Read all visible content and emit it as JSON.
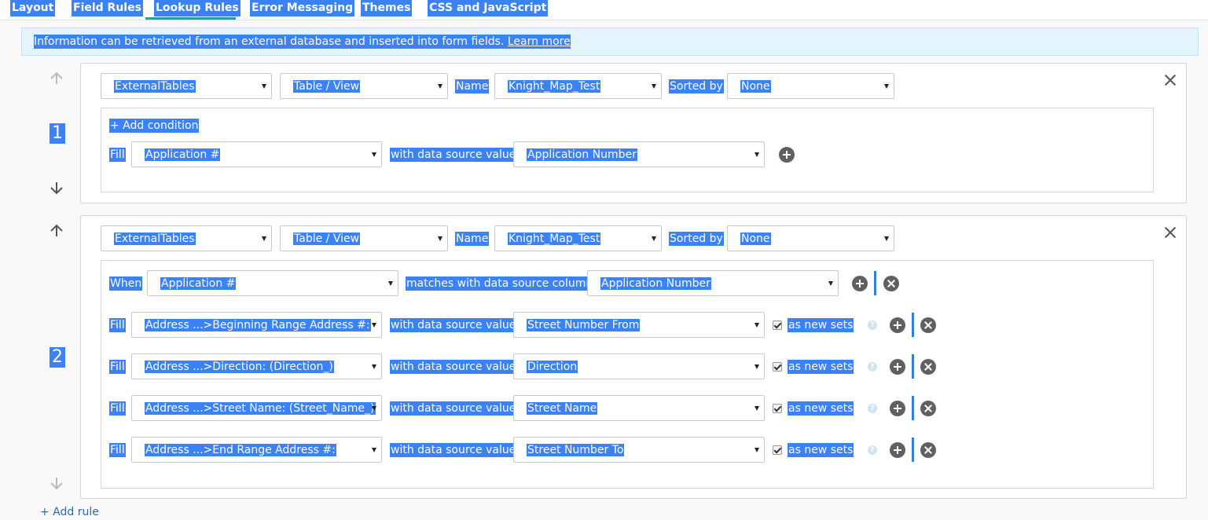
{
  "tabs": [
    {
      "label": "Layout"
    },
    {
      "label": "Field Rules"
    },
    {
      "label": "Lookup Rules"
    },
    {
      "label": "Error Messaging"
    },
    {
      "label": "Themes"
    },
    {
      "label": "CSS and JavaScript"
    }
  ],
  "banner": {
    "text": "Information can be retrieved from an external database and inserted into form fields.",
    "link": "Learn more"
  },
  "common": {
    "name_label": "Name",
    "sorted_by_label": "Sorted by",
    "fill_label": "Fill",
    "when_label": "When",
    "with_value_label": "with data source value",
    "matches_label": "matches with data source column",
    "as_new_sets_label": "as new sets",
    "add_condition": "+ Add condition",
    "help_glyph": "?"
  },
  "rules": [
    {
      "number": "1",
      "source": "ExternalTables",
      "type": "Table / View",
      "name": "Knight_Map_Test",
      "sorted_by": "None",
      "fills": [
        {
          "field": "Application #",
          "value": "Application Number"
        }
      ]
    },
    {
      "number": "2",
      "source": "ExternalTables",
      "type": "Table / View",
      "name": "Knight_Map_Test",
      "sorted_by": "None",
      "condition": {
        "field": "Application #",
        "column": "Application Number"
      },
      "fills": [
        {
          "field": "Address ...>Beginning Range Address #:",
          "value": "Street Number From",
          "new_sets": true
        },
        {
          "field": "Address ...>Direction: (Direction_)",
          "value": "Direction",
          "new_sets": true
        },
        {
          "field": "Address ...>Street Name: (Street_Name_)",
          "value": "Street Name",
          "new_sets": true
        },
        {
          "field": "Address ...>End Range Address #:",
          "value": "Street Number To",
          "new_sets": true
        }
      ]
    }
  ],
  "add_rule": "+ Add rule",
  "colors": {
    "selection": "#3b82f6",
    "tab_active": "#2b9e8f",
    "banner_bg": "#e3f4fc",
    "link": "#2c6ea8"
  }
}
